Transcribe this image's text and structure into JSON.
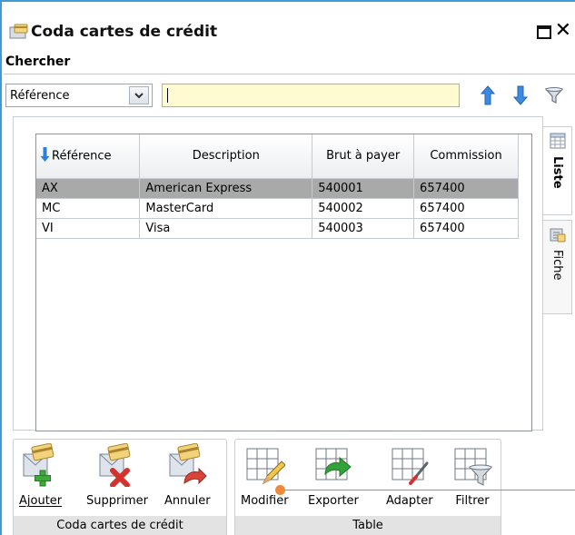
{
  "window": {
    "title": "Coda cartes de crédit"
  },
  "search": {
    "section_label": "Chercher",
    "field_value": "Référence",
    "input_value": ""
  },
  "table": {
    "sort_column": "Référence",
    "headers": [
      "Référence",
      "Description",
      "Brut à payer",
      "Commission"
    ],
    "rows": [
      [
        "AX",
        "American Express",
        "540001",
        "657400"
      ],
      [
        "MC",
        "MasterCard",
        "540002",
        "657400"
      ],
      [
        "VI",
        "Visa",
        "540003",
        "657400"
      ]
    ],
    "selected_row": 0
  },
  "tabs": [
    {
      "label": "Liste",
      "active": true
    },
    {
      "label": "Fiche",
      "active": false
    }
  ],
  "ribbon": {
    "groups": [
      {
        "caption": "Coda cartes de crédit",
        "buttons": [
          {
            "label": "Ajouter",
            "icon": "add-record-icon"
          },
          {
            "label": "Supprimer",
            "icon": "delete-record-icon"
          },
          {
            "label": "Annuler",
            "icon": "cancel-record-icon"
          }
        ]
      },
      {
        "caption": "Table",
        "buttons": [
          {
            "label": "Modifier",
            "icon": "table-edit-icon"
          },
          {
            "label": "Exporter",
            "icon": "table-export-icon"
          },
          {
            "label": "Adapter",
            "icon": "table-adapt-icon"
          },
          {
            "label": "Filtrer",
            "icon": "table-filter-icon"
          }
        ]
      }
    ]
  },
  "colors": {
    "accent_border": "#3f9bd6",
    "search_input_bg": "#fffbd0",
    "selected_row": "#a9a9a9",
    "arrow_blue": "#2f7fd6",
    "pointer": "#e87a2a"
  }
}
